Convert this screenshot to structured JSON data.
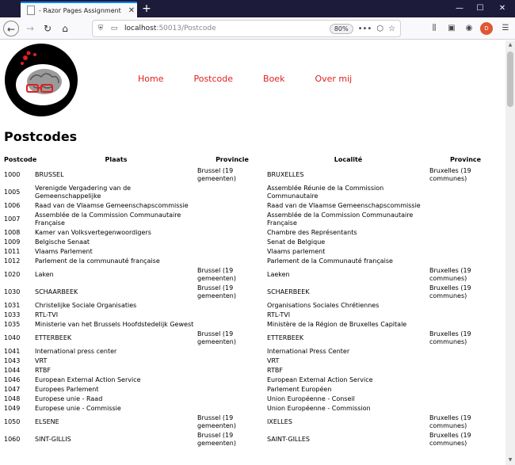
{
  "browser": {
    "tab_title": "- Razor Pages Assignment",
    "url_host": "localhost",
    "url_port_path": ":50013/Postcode",
    "zoom": "80%"
  },
  "nav": {
    "items": [
      "Home",
      "Postcode",
      "Boek",
      "Over mij"
    ]
  },
  "page": {
    "title": "Postcodes"
  },
  "table": {
    "headers": [
      "Postcode",
      "Plaats",
      "Provincie",
      "Localité",
      "Province"
    ],
    "rows": [
      [
        "1000",
        "BRUSSEL",
        "Brussel (19 gemeenten)",
        "BRUXELLES",
        "Bruxelles (19 communes)"
      ],
      [
        "1005",
        "Verenigde Vergadering van de Gemeenschappelijke",
        "",
        "Assemblée Réunie de la Commission Communautaire",
        ""
      ],
      [
        "1006",
        "Raad van de Vlaamse Gemeenschapscommissie",
        "",
        "Raad van de Vlaamse Gemeenschapscommissie",
        ""
      ],
      [
        "1007",
        "Assemblée de la Commission Communautaire Française",
        "",
        "Assemblée de la Commission Communautaire Française",
        ""
      ],
      [
        "1008",
        "Kamer van Volksvertegenwoordigers",
        "",
        "Chambre des Représentants",
        ""
      ],
      [
        "1009",
        "Belgische Senaat",
        "",
        "Senat de Belgique",
        ""
      ],
      [
        "1011",
        "Vlaams Parlement",
        "",
        "Vlaams parlement",
        ""
      ],
      [
        "1012",
        "Parlement de la communauté française",
        "",
        "Parlement de la Communauté française",
        ""
      ],
      [
        "1020",
        "Laken",
        "Brussel (19 gemeenten)",
        "Laeken",
        "Bruxelles (19 communes)"
      ],
      [
        "1030",
        "SCHAARBEEK",
        "Brussel (19 gemeenten)",
        "SCHAERBEEK",
        "Bruxelles (19 communes)"
      ],
      [
        "1031",
        "Christelijke Sociale Organisaties",
        "",
        "Organisations Sociales Chrétiennes",
        ""
      ],
      [
        "1033",
        "RTL-TVI",
        "",
        "RTL-TVI",
        ""
      ],
      [
        "1035",
        "Ministerie van het Brussels Hoofdstedelijk Gewest",
        "",
        "Ministère de la Région de Bruxelles Capitale",
        ""
      ],
      [
        "1040",
        "ETTERBEEK",
        "Brussel (19 gemeenten)",
        "ETTERBEEK",
        "Bruxelles (19 communes)"
      ],
      [
        "1041",
        "International press center",
        "",
        "International Press Center",
        ""
      ],
      [
        "1043",
        "VRT",
        "",
        "VRT",
        ""
      ],
      [
        "1044",
        "RTBF",
        "",
        "RTBF",
        ""
      ],
      [
        "1046",
        "European External Action Service",
        "",
        "European External Action Service",
        ""
      ],
      [
        "1047",
        "Europees Parlement",
        "",
        "Parlement Européen",
        ""
      ],
      [
        "1048",
        "Europese unie - Raad",
        "",
        "Union Européenne - Conseil",
        ""
      ],
      [
        "1049",
        "Europese unie - Commissie",
        "",
        "Union Européenne - Commission",
        ""
      ],
      [
        "1050",
        "ELSENE",
        "Brussel (19 gemeenten)",
        "IXELLES",
        "Bruxelles (19 communes)"
      ],
      [
        "1060",
        "SINT-GILLIS",
        "Brussel (19 gemeenten)",
        "SAINT-GILLES",
        "Bruxelles (19 communes)"
      ]
    ]
  },
  "colors": {
    "nav_link": "#e02020",
    "tabbar": "#1c1b3a"
  }
}
